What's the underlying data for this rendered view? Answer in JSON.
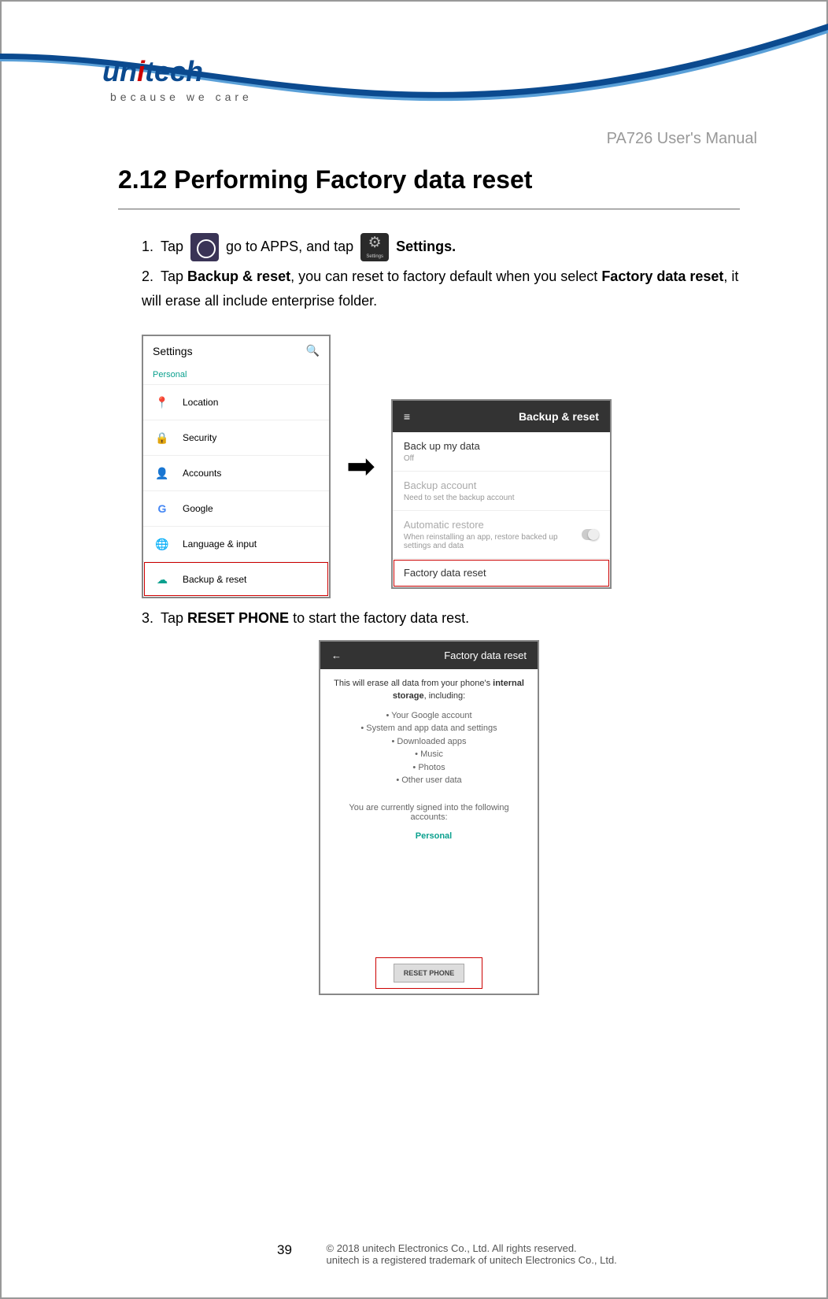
{
  "brand": {
    "name": "unitech",
    "tagline": "because we care"
  },
  "manual_title": "PA726 User's Manual",
  "section": {
    "number": "2.12",
    "title": "Performing Factory data reset"
  },
  "steps": {
    "s1": {
      "num": "1.",
      "a": "Tap ",
      "b": " go to APPS, and tap ",
      "c": " Settings."
    },
    "s2": {
      "num": "2.",
      "a": "Tap ",
      "b": "Backup & reset",
      "c": ", you can reset to factory default when you select ",
      "d": "Factory data reset",
      "e": ", it will erase all include enterprise folder."
    },
    "s3": {
      "num": "3.",
      "a": "Tap ",
      "b": "RESET PHONE",
      "c": " to start the factory data rest."
    }
  },
  "screen1": {
    "title": "Settings",
    "section": "Personal",
    "items": [
      {
        "label": "Location",
        "icon": "📍",
        "color": "#0aa08e"
      },
      {
        "label": "Security",
        "icon": "🔒",
        "color": "#0aa08e"
      },
      {
        "label": "Accounts",
        "icon": "👤",
        "color": "#0aa08e"
      },
      {
        "label": "Google",
        "icon": "G",
        "color": "#4285F4"
      },
      {
        "label": "Language & input",
        "icon": "🌐",
        "color": "#0aa08e"
      },
      {
        "label": "Backup & reset",
        "icon": "☁",
        "color": "#0aa08e"
      }
    ]
  },
  "screen2": {
    "title": "Backup & reset",
    "items": {
      "backup": {
        "primary": "Back up my data",
        "secondary": "Off"
      },
      "account": {
        "primary": "Backup account",
        "secondary": "Need to set the backup account"
      },
      "restore": {
        "primary": "Automatic restore",
        "secondary": "When reinstalling an app, restore backed up settings and data"
      },
      "factory": {
        "primary": "Factory data reset"
      }
    }
  },
  "screen3": {
    "title": "Factory data reset",
    "intro_a": "This will erase all data from your phone's ",
    "intro_b": "internal storage",
    "intro_c": ", including:",
    "bullets": [
      "Your Google account",
      "System and app data and settings",
      "Downloaded apps",
      "Music",
      "Photos",
      "Other user data"
    ],
    "accounts_note": "You are currently signed into the following accounts:",
    "personal": "Personal",
    "button": "RESET PHONE"
  },
  "footer": {
    "page": "39",
    "line1": "© 2018 unitech Electronics Co., Ltd. All rights reserved.",
    "line2": "unitech is a registered trademark of unitech Electronics Co., Ltd."
  }
}
